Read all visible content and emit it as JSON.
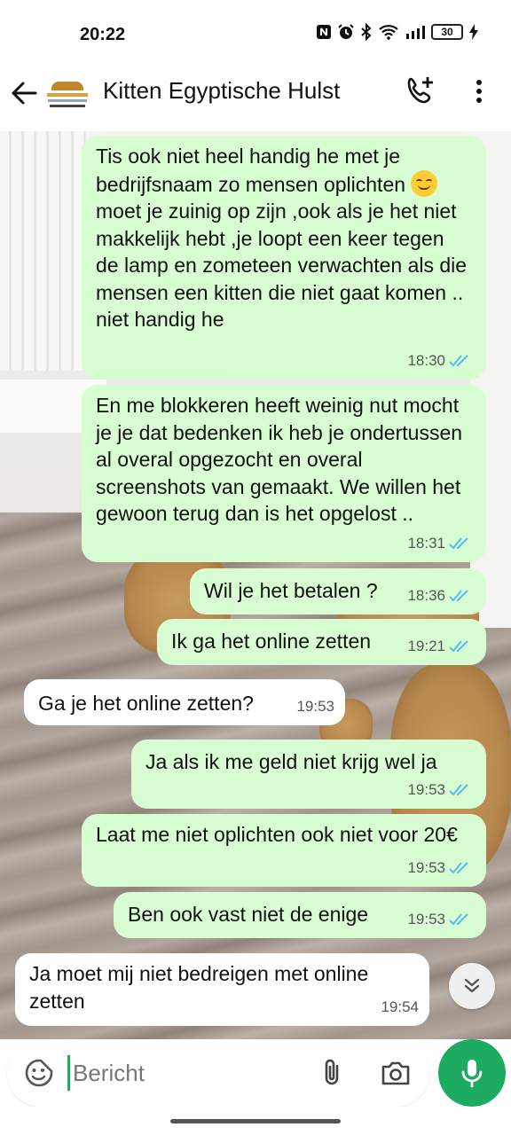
{
  "status_bar": {
    "time": "20:22",
    "battery": "30"
  },
  "header": {
    "contact_name": "Kitten Egyptische Hulst"
  },
  "messages": [
    {
      "direction": "outgoing",
      "text_before_emoji": "Tis ook niet heel handig he met je bedrijfsnaam zo mensen oplichten",
      "emoji": "smirking-face",
      "text_after_emoji": "moet je zuinig op zijn ,ook als je het niet makkelijk hebt ,je loopt een keer tegen de lamp en zometeen verwachten als die mensen een kitten die niet gaat komen .. niet handig he",
      "time": "18:30",
      "status": "read"
    },
    {
      "direction": "outgoing",
      "text": "En me blokkeren heeft weinig nut mocht je je dat bedenken ik heb je ondertussen al overal opgezocht en overal screenshots van gemaakt. We willen het gewoon terug dan is het opgelost ..",
      "time": "18:31",
      "status": "read"
    },
    {
      "direction": "outgoing",
      "text": "Wil je het betalen ?",
      "time": "18:36",
      "status": "read"
    },
    {
      "direction": "outgoing",
      "text": "Ik ga het online zetten",
      "time": "19:21",
      "status": "read"
    },
    {
      "direction": "incoming",
      "text": "Ga je het online zetten?",
      "time": "19:53"
    },
    {
      "direction": "outgoing",
      "text": "Ja als ik me geld niet krijg wel ja",
      "time": "19:53",
      "status": "read"
    },
    {
      "direction": "outgoing",
      "text": "Laat me niet oplichten ook niet voor 20€",
      "time": "19:53",
      "status": "read"
    },
    {
      "direction": "outgoing",
      "text": "Ben ook vast niet de enige",
      "time": "19:53",
      "status": "read"
    },
    {
      "direction": "incoming",
      "text": "Ja moet mij niet bedreigen met online zetten",
      "time": "19:54"
    }
  ],
  "composer": {
    "placeholder": "Bericht",
    "value": ""
  },
  "colors": {
    "outgoing_bubble": "#d9fdd3",
    "incoming_bubble": "#ffffff",
    "accent": "#1daa61",
    "read_ticks": "#53bdeb"
  }
}
